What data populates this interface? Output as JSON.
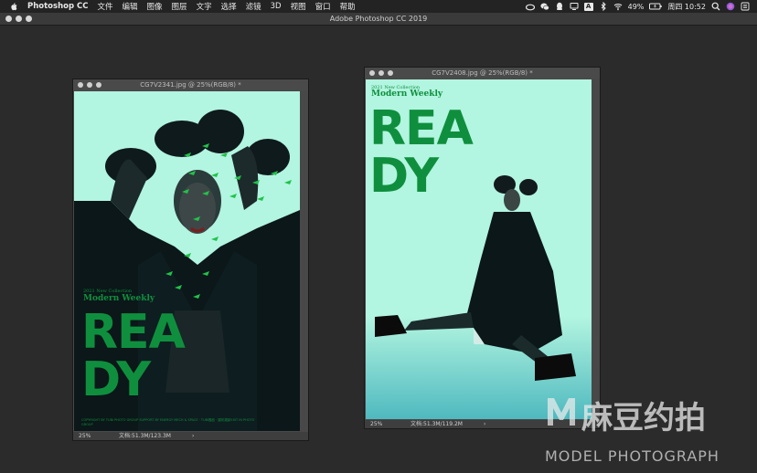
{
  "menubar": {
    "app_name": "Photoshop CC",
    "items": [
      "文件",
      "编辑",
      "图像",
      "图层",
      "文字",
      "选择",
      "滤镜",
      "3D",
      "视图",
      "窗口",
      "帮助"
    ],
    "ime_label": "A",
    "battery": "49%",
    "clock": "周四 10:52"
  },
  "app_window": {
    "title": "Adobe Photoshop CC 2019"
  },
  "documents": [
    {
      "title": "CG7V2341.jpg @ 25%(RGB/8) *",
      "zoom": "25%",
      "file_size": "文档:51.3M/123.3M",
      "arrow": "›",
      "poster": {
        "collection": "2021 New Collection",
        "brand": "Modern Weekly",
        "headline_1": "REA",
        "headline_2": "DY",
        "fine_print": "COPYRIGHT BY TUBI PHOTO GROUP SUPPORT BY ENERGY MECH & SPACE · TUBI團品 · 圖彩攝影EXIT IN PHOTO GROUP"
      }
    },
    {
      "title": "CG7V2408.jpg @ 25%(RGB/8) *",
      "zoom": "25%",
      "file_size": "文档:51.3M/119.2M",
      "arrow": "›",
      "poster": {
        "collection": "2021 New Collection",
        "brand": "Modern Weekly",
        "headline_1": "REA",
        "headline_2": "DY"
      }
    }
  ],
  "watermark": {
    "brand_cn": "麻豆约拍",
    "brand_en": "MODEL PHOTOGRAPH"
  },
  "icons": [
    "apple-icon",
    "wechat-icon",
    "qq-icon",
    "bluetooth-icon",
    "wifi-icon",
    "battery-icon",
    "search-icon",
    "siri-icon",
    "list-icon"
  ]
}
